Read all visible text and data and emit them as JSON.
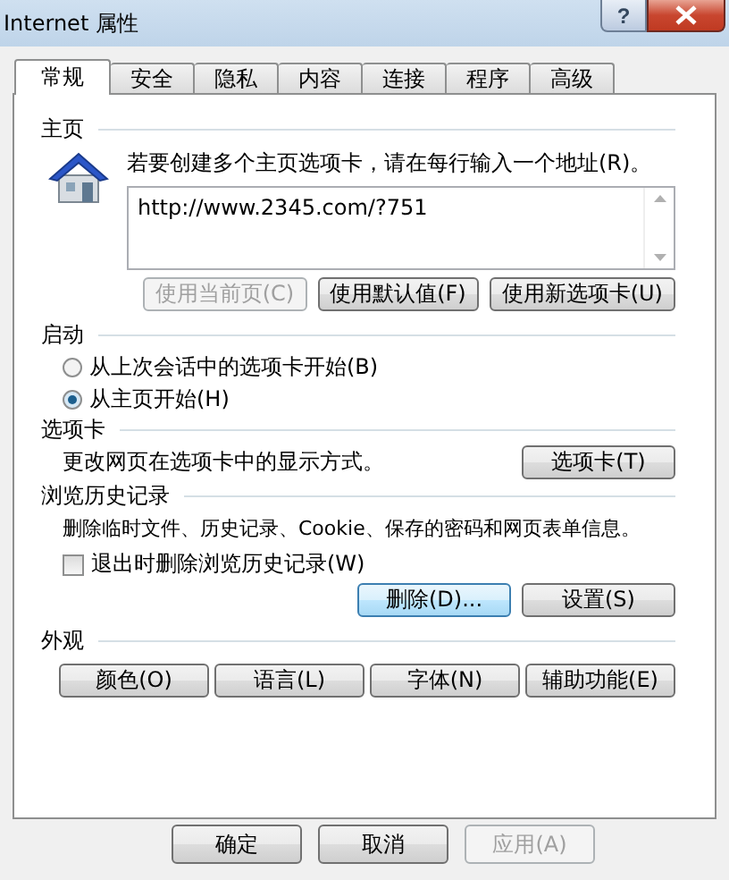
{
  "window": {
    "title": "Internet 属性",
    "help": "?"
  },
  "tabs": [
    {
      "label": "常规",
      "selected": true
    },
    {
      "label": "安全",
      "selected": false
    },
    {
      "label": "隐私",
      "selected": false
    },
    {
      "label": "内容",
      "selected": false
    },
    {
      "label": "连接",
      "selected": false
    },
    {
      "label": "程序",
      "selected": false
    },
    {
      "label": "高级",
      "selected": false
    }
  ],
  "home_page": {
    "label": "主页",
    "instruction": "若要创建多个主页选项卡，请在每行输入一个地址(R)。",
    "addresses": "http://www.2345.com/?751",
    "buttons": [
      {
        "label": "使用当前页(C)",
        "disabled": true
      },
      {
        "label": "使用默认值(F)",
        "disabled": false
      },
      {
        "label": "使用新选项卡(U)",
        "disabled": false
      }
    ]
  },
  "startup": {
    "label": "启动",
    "options": [
      {
        "label": "从上次会话中的选项卡开始(B)",
        "selected": false
      },
      {
        "label": "从主页开始(H)",
        "selected": true
      }
    ]
  },
  "tabs_section": {
    "label": "选项卡",
    "description": "更改网页在选项卡中的显示方式。",
    "button": "选项卡(T)"
  },
  "history": {
    "label": "浏览历史记录",
    "description": "删除临时文件、历史记录、Cookie、保存的密码和网页表单信息。",
    "checkbox": {
      "label": "退出时删除浏览历史记录(W)",
      "checked": false
    },
    "buttons": [
      {
        "label": "删除(D)...",
        "focused": true
      },
      {
        "label": "设置(S)",
        "focused": false
      }
    ]
  },
  "appearance": {
    "label": "外观",
    "buttons": [
      "颜色(O)",
      "语言(L)",
      "字体(N)",
      "辅助功能(E)"
    ]
  },
  "footer_buttons": [
    {
      "label": "确定",
      "disabled": false
    },
    {
      "label": "取消",
      "disabled": false
    },
    {
      "label": "应用(A)",
      "disabled": true
    }
  ]
}
